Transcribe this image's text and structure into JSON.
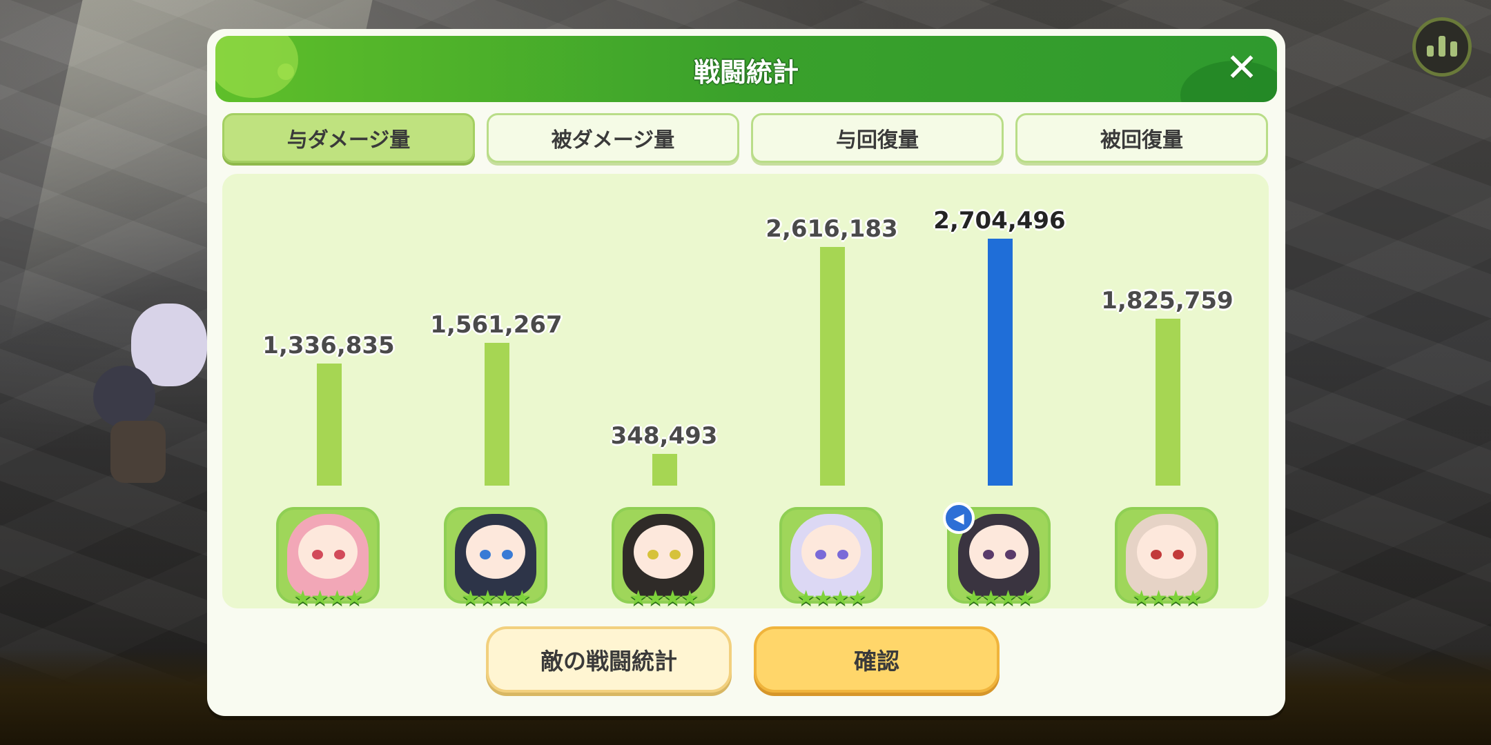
{
  "dialog": {
    "title": "戦闘統計",
    "close_glyph": "✕"
  },
  "tabs": [
    {
      "label": "与ダメージ量",
      "active": true
    },
    {
      "label": "被ダメージ量",
      "active": false
    },
    {
      "label": "与回復量",
      "active": false
    },
    {
      "label": "被回復量",
      "active": false
    }
  ],
  "characters": [
    {
      "value_label": "1,336,835",
      "stars": "★★★★",
      "hair_color": "#f2a7b7",
      "eye_color": "#d24a5a"
    },
    {
      "value_label": "1,561,267",
      "stars": "★★★★",
      "hair_color": "#2d3448",
      "eye_color": "#3a7bd5"
    },
    {
      "value_label": "348,493",
      "stars": "★★★★",
      "hair_color": "#2f2b28",
      "eye_color": "#d6c23a"
    },
    {
      "value_label": "2,616,183",
      "stars": "★★★★",
      "hair_color": "#dcd8f4",
      "eye_color": "#7a6ad8"
    },
    {
      "value_label": "2,704,496",
      "stars": "★★★★",
      "hair_color": "#3a3440",
      "eye_color": "#5a3a6a",
      "badge": "◀"
    },
    {
      "value_label": "1,825,759",
      "stars": "★★★★",
      "hair_color": "#e6d3c6",
      "eye_color": "#c23a3a"
    }
  ],
  "chart_data": {
    "type": "bar",
    "categories": [
      "1",
      "2",
      "3",
      "4",
      "5",
      "6"
    ],
    "values": [
      1336835,
      1561267,
      348493,
      2616183,
      2704496,
      1825759
    ],
    "highlight_index": 4,
    "bar_color": "#a6d653",
    "highlight_color": "#1f6ed8",
    "ylim": [
      0,
      2704496
    ]
  },
  "buttons": {
    "enemy_stats": "敵の戦闘統計",
    "confirm": "確認"
  },
  "colors": {
    "header_green": "#3aa12b",
    "panel_bg": "#ebf8cf",
    "tab_active": "#bfe27f",
    "confirm_yellow": "#ffd66a"
  }
}
